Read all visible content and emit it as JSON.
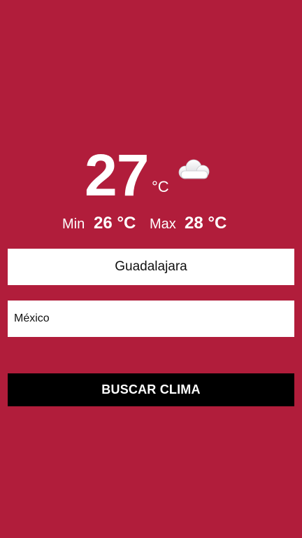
{
  "weather": {
    "temperature": "27",
    "unit": "°C",
    "icon": "cloud-icon",
    "min_label": "Min",
    "min_value": "26 °C",
    "max_label": "Max",
    "max_value": "28 °C"
  },
  "form": {
    "city_value": "Guadalajara",
    "country_value": "México",
    "button_label": "BUSCAR CLIMA"
  },
  "colors": {
    "background": "#b11d3b",
    "button": "#000000",
    "field": "#ffffff"
  }
}
